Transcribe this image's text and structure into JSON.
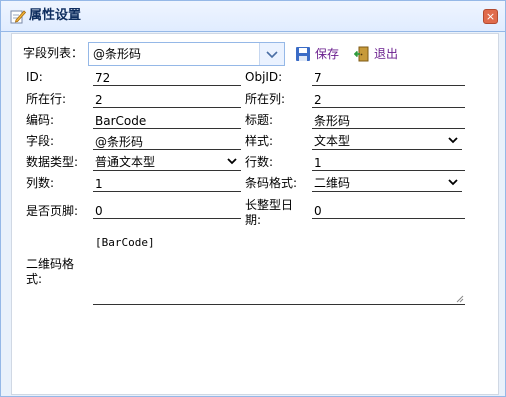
{
  "window": {
    "title": "属性设置",
    "close_symbol": "×"
  },
  "toolbar": {
    "field_list_label": "字段列表：",
    "field_list_value": "@条形码",
    "save_label": "保存",
    "exit_label": "退出"
  },
  "form": {
    "id_label": "ID:",
    "id_value": "72",
    "objid_label": "ObjID:",
    "objid_value": "7",
    "row_label": "所在行:",
    "row_value": "2",
    "col_label": "所在列:",
    "col_value": "2",
    "code_label": "编码:",
    "code_value": "BarCode",
    "caption_label": "标题:",
    "caption_value": "条形码",
    "field_label": "字段:",
    "field_value": "@条形码",
    "style_label": "样式:",
    "style_value": "文本型",
    "datatype_label": "数据类型:",
    "datatype_value": "普通文本型",
    "rows_label": "行数:",
    "rows_value": "1",
    "cols_label": "列数:",
    "cols_value": "1",
    "barcode_format_label": "条码格式:",
    "barcode_format_value": "二维码",
    "footer_label": "是否页脚:",
    "footer_value": "0",
    "long_date_label": "长整型日期:",
    "long_date_value": "0",
    "qr_format_label": "二维码格式:",
    "qr_format_value": "[BarCode]"
  },
  "colors": {
    "accent": "#95b8e7",
    "close": "#e06b4c",
    "button_text": "#6a1e8e"
  }
}
